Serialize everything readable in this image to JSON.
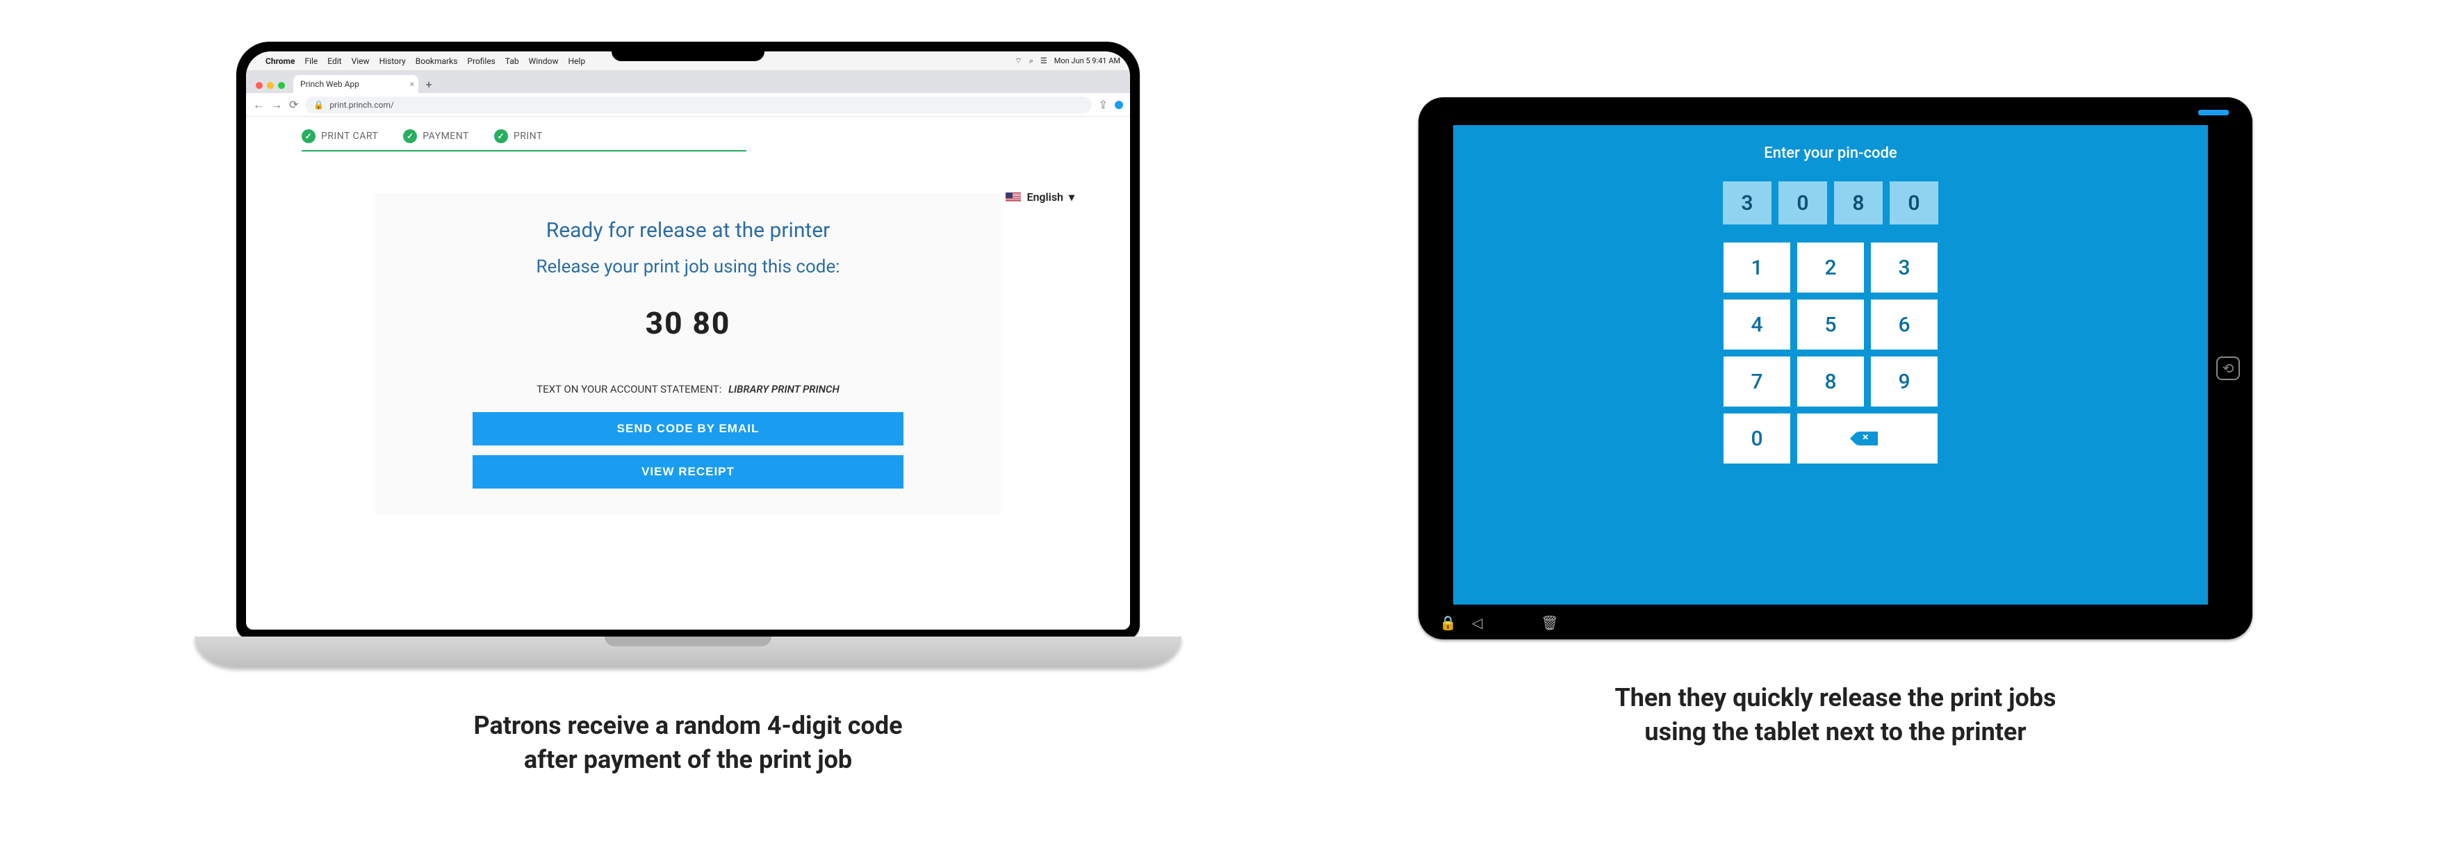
{
  "mac_menu": {
    "app": "Chrome",
    "items": [
      "File",
      "Edit",
      "View",
      "History",
      "Bookmarks",
      "Profiles",
      "Tab",
      "Window",
      "Help"
    ],
    "clock": "Mon Jun 5  9:41 AM"
  },
  "browser": {
    "tab_title": "Princh Web App",
    "url": "print.princh.com/",
    "lang_label": "English"
  },
  "steps": {
    "s1": "PRINT CART",
    "s2": "PAYMENT",
    "s3": "PRINT"
  },
  "card": {
    "headline": "Ready for release at the printer",
    "subhead": "Release your print job using this code:",
    "code": "30 80",
    "stmt_label": "TEXT ON YOUR ACCOUNT STATEMENT:",
    "stmt_value": "LIBRARY PRINT PRINCH",
    "btn_email": "SEND CODE BY EMAIL",
    "btn_receipt": "VIEW RECEIPT"
  },
  "tablet": {
    "title": "Enter your pin-code",
    "pin": [
      "3",
      "0",
      "8",
      "0"
    ],
    "keys": [
      "1",
      "2",
      "3",
      "4",
      "5",
      "6",
      "7",
      "8",
      "9",
      "0"
    ]
  },
  "captions": {
    "left_l1": "Patrons receive a random 4-digit code",
    "left_l2": "after payment of the print job",
    "right_l1": "Then they quickly release the print jobs",
    "right_l2": "using the tablet next to the printer"
  }
}
